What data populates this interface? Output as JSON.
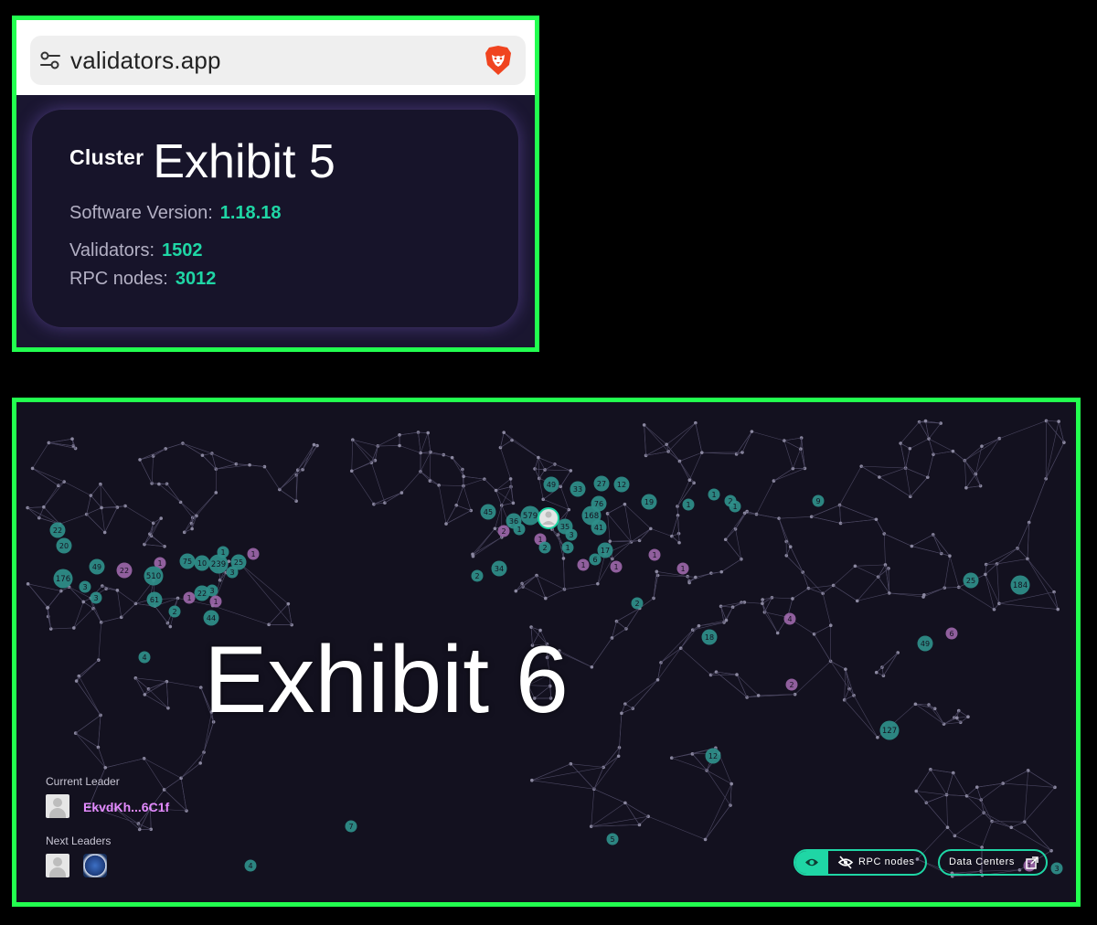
{
  "browser": {
    "url": "validators.app"
  },
  "cluster": {
    "label": "Cluster",
    "name": "Exhibit 5",
    "software_version_label": "Software Version:",
    "software_version": "1.18.18",
    "validators_label": "Validators:",
    "validators": "1502",
    "rpc_label": "RPC nodes:",
    "rpc": "3012"
  },
  "map": {
    "overlay_title": "Exhibit 6",
    "current_leader_label": "Current Leader",
    "current_leader": "EkvdKh...6C1f",
    "next_leaders_label": "Next Leaders",
    "rpc_toggle_label": "RPC nodes",
    "data_centers_label": "Data Centers",
    "markers": [
      {
        "label": "22",
        "c": "t"
      },
      {
        "label": "20",
        "c": "t"
      },
      {
        "label": "176",
        "c": "t"
      },
      {
        "label": "3",
        "c": "t"
      },
      {
        "label": "3",
        "c": "t"
      },
      {
        "label": "49",
        "c": "t"
      },
      {
        "label": "22",
        "c": "p"
      },
      {
        "label": "1",
        "c": "p"
      },
      {
        "label": "510",
        "c": "t"
      },
      {
        "label": "61",
        "c": "t"
      },
      {
        "label": "2",
        "c": "t"
      },
      {
        "label": "1",
        "c": "p"
      },
      {
        "label": "22",
        "c": "t"
      },
      {
        "label": "3",
        "c": "t"
      },
      {
        "label": "1",
        "c": "p"
      },
      {
        "label": "44",
        "c": "t"
      },
      {
        "label": "75",
        "c": "t"
      },
      {
        "label": "10",
        "c": "t"
      },
      {
        "label": "239",
        "c": "t"
      },
      {
        "label": "1",
        "c": "t"
      },
      {
        "label": "25",
        "c": "t"
      },
      {
        "label": "3",
        "c": "t"
      },
      {
        "label": "1",
        "c": "p"
      },
      {
        "label": "4",
        "c": "t"
      },
      {
        "label": "45",
        "c": "t"
      },
      {
        "label": "36",
        "c": "t"
      },
      {
        "label": "579",
        "c": "t"
      },
      {
        "label": "1",
        "c": "t"
      },
      {
        "label": "2",
        "c": "p"
      },
      {
        "label": "1",
        "c": "p"
      },
      {
        "label": "2",
        "c": "t"
      },
      {
        "label": "1",
        "c": "t"
      },
      {
        "label": "3",
        "c": "t"
      },
      {
        "label": "35",
        "c": "t"
      },
      {
        "label": "49",
        "c": "t"
      },
      {
        "label": "33",
        "c": "t"
      },
      {
        "label": "27",
        "c": "t"
      },
      {
        "label": "12",
        "c": "t"
      },
      {
        "label": "76",
        "c": "t"
      },
      {
        "label": "168",
        "c": "t"
      },
      {
        "label": "41",
        "c": "t"
      },
      {
        "label": "17",
        "c": "t"
      },
      {
        "label": "6",
        "c": "t"
      },
      {
        "label": "1",
        "c": "p"
      },
      {
        "label": "1",
        "c": "p"
      },
      {
        "label": "34",
        "c": "t"
      },
      {
        "label": "2",
        "c": "t"
      },
      {
        "label": "19",
        "c": "t"
      },
      {
        "label": "1",
        "c": "t"
      },
      {
        "label": "1",
        "c": "t"
      },
      {
        "label": "2",
        "c": "t"
      },
      {
        "label": "1",
        "c": "t"
      },
      {
        "label": "9",
        "c": "t"
      },
      {
        "label": "1",
        "c": "p"
      },
      {
        "label": "1",
        "c": "p"
      },
      {
        "label": "2",
        "c": "t"
      },
      {
        "label": "4",
        "c": "p"
      },
      {
        "label": "18",
        "c": "t"
      },
      {
        "label": "2",
        "c": "p"
      },
      {
        "label": "25",
        "c": "t"
      },
      {
        "label": "184",
        "c": "t"
      },
      {
        "label": "6",
        "c": "p"
      },
      {
        "label": "49",
        "c": "t"
      },
      {
        "label": "127",
        "c": "t"
      },
      {
        "label": "12",
        "c": "t"
      },
      {
        "label": "7",
        "c": "t"
      },
      {
        "label": "4",
        "c": "t"
      },
      {
        "label": "5",
        "c": "t"
      },
      {
        "label": "1",
        "c": "p"
      },
      {
        "label": "3",
        "c": "t"
      }
    ]
  },
  "colors": {
    "accent": "#1fd6a5",
    "teal_marker": "#2f8f8a",
    "purple_marker": "#9b66a8",
    "leader_key": "#e48bff",
    "frame": "#22ff4f"
  }
}
